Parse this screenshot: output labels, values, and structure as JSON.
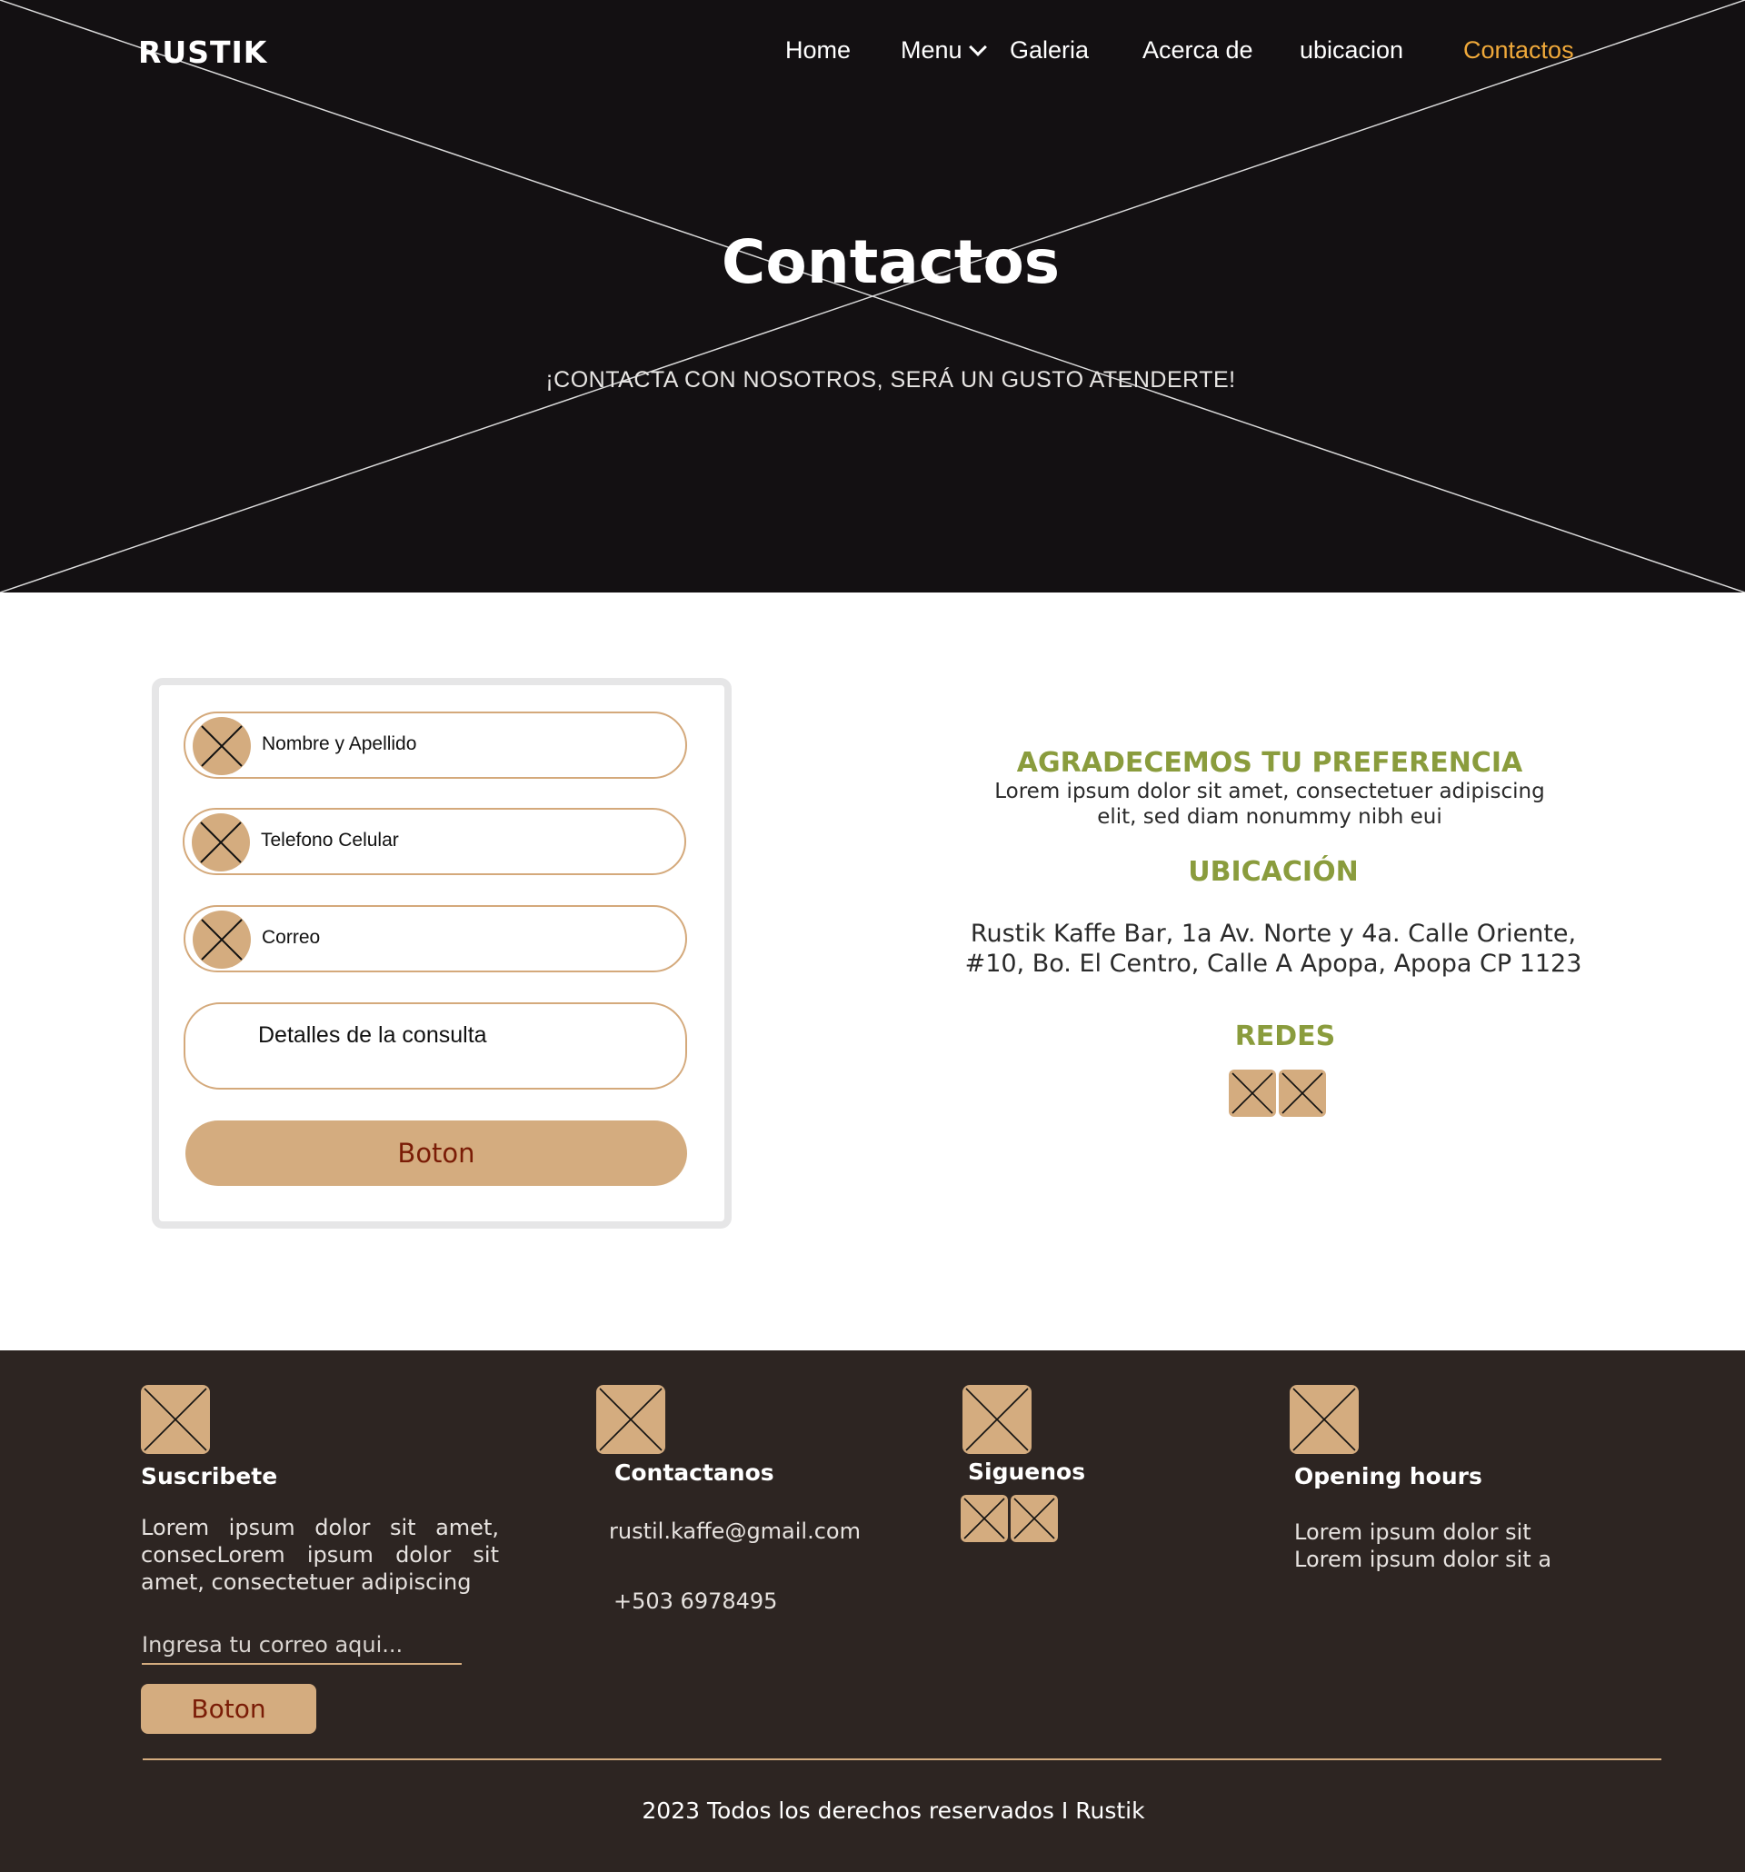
{
  "brand": "RUSTIK",
  "nav": {
    "items": [
      {
        "label": "Home"
      },
      {
        "label": "Menu",
        "has_dropdown": true
      },
      {
        "label": "Galeria"
      },
      {
        "label": "Acerca de"
      },
      {
        "label": "ubicacion"
      },
      {
        "label": "Contactos",
        "active": true
      }
    ],
    "active_color": "#f0a93a"
  },
  "hero": {
    "title": "Contactos",
    "subtitle": "¡CONTACTA CON NOSOTROS, SERÁ UN GUSTO ATENDERTE!"
  },
  "form": {
    "fields": [
      {
        "label": "Nombre y Apellido",
        "icon": "placeholder-image-icon"
      },
      {
        "label": "Telefono Celular",
        "icon": "placeholder-image-icon"
      },
      {
        "label": "Correo",
        "icon": "placeholder-image-icon"
      }
    ],
    "details_label": "Detalles de la consulta",
    "button_label": "Boton"
  },
  "info": {
    "thanks_heading": "AGRADECEMOS TU PREFERENCIA",
    "thanks_text_line1": "Lorem ipsum dolor sit amet, consectetuer adipiscing",
    "thanks_text_line2": "elit, sed diam nonummy nibh eui",
    "location_heading": "UBICACIÓN",
    "address_line1": "Rustik Kaffe Bar, 1a Av. Norte y 4a. Calle Oriente,",
    "address_line2": "#10, Bo. El Centro, Calle A Apopa, Apopa CP 1123",
    "social_heading": "REDES"
  },
  "footer": {
    "subscribe": {
      "heading": "Suscribete",
      "text": "Lorem ipsum dolor sit amet, consecLorem ipsum dolor sit amet, consectetuer adipiscing",
      "input_placeholder": "Ingresa tu correo aqui...",
      "button_label": "Boton"
    },
    "contact": {
      "heading": "Contactanos",
      "email": "rustil.kaffe@gmail.com",
      "phone": "+503 6978495"
    },
    "follow": {
      "heading": "Siguenos"
    },
    "hours": {
      "heading": "Opening hours",
      "line1": "Lorem ipsum dolor sit",
      "line2": "Lorem ipsum dolor sit a"
    },
    "copyright": "2023 Todos los derechos reservados I Rustik"
  },
  "colors": {
    "hero_bg": "#131012",
    "accent_tan": "#d4ac7f",
    "heading_olive": "#8a9c3d",
    "button_text": "#7a1c06",
    "footer_bg": "#2d2522"
  }
}
